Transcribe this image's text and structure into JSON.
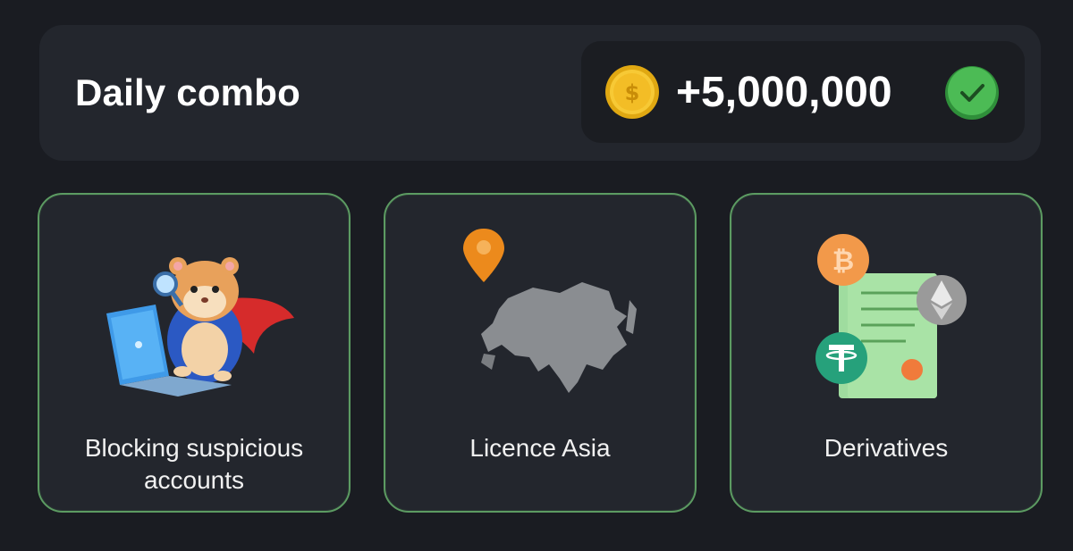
{
  "header": {
    "title": "Daily combo",
    "reward": "+5,000,000",
    "coin_icon": "gold-dollar-coin-icon",
    "status_icon": "green-check-icon"
  },
  "cards": [
    {
      "label": "Blocking suspicious accounts",
      "icon": "hamster-hero-laptop-illustration"
    },
    {
      "label": "Licence Asia",
      "icon": "asia-map-pin-illustration"
    },
    {
      "label": "Derivatives",
      "icon": "crypto-contract-illustration"
    }
  ],
  "colors": {
    "background": "#1a1c22",
    "panel": "#23262d",
    "card_border": "#5c9b62",
    "coin": "#f4c430",
    "check": "#4caf50"
  }
}
